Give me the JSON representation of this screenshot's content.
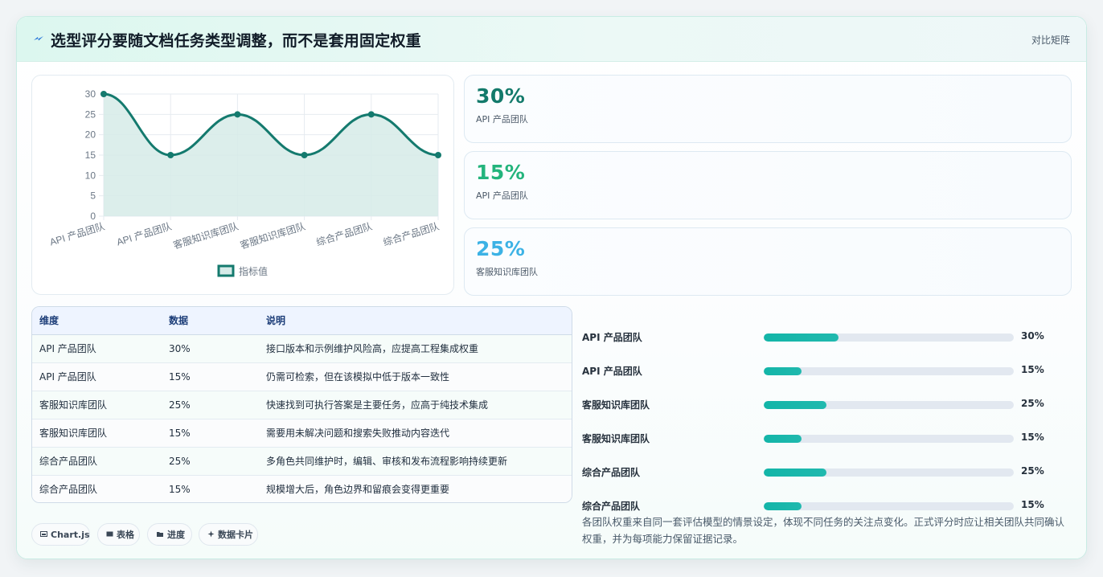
{
  "header": {
    "title": "选型评分要随文档任务类型调整，而不是套用固定权重",
    "link": "对比矩阵"
  },
  "chart_data": {
    "type": "line",
    "categories": [
      "API 产品团队",
      "API 产品团队",
      "客服知识库团队",
      "客服知识库团队",
      "综合产品团队",
      "综合产品团队"
    ],
    "series": [
      {
        "name": "指标值",
        "values": [
          30,
          15,
          25,
          15,
          25,
          15
        ]
      }
    ],
    "ylim": [
      0,
      30
    ],
    "yticks": [
      "0",
      "5",
      "10",
      "15",
      "20",
      "25",
      "30"
    ],
    "grid": true,
    "legend": "bottom",
    "fill": true,
    "color": "#147a6e",
    "fill_color": "#d6ebe8"
  },
  "stats": [
    {
      "value": "30%",
      "label": "API 产品团队",
      "color": "#137a6b"
    },
    {
      "value": "15%",
      "label": "API 产品团队",
      "color": "#23b47c"
    },
    {
      "value": "25%",
      "label": "客服知识库团队",
      "color": "#3cb2e5"
    }
  ],
  "table": {
    "headers": [
      "维度",
      "数据",
      "说明"
    ],
    "rows": [
      [
        "API 产品团队",
        "30%",
        "接口版本和示例维护风险高，应提高工程集成权重"
      ],
      [
        "API 产品团队",
        "15%",
        "仍需可检索，但在该模拟中低于版本一致性"
      ],
      [
        "客服知识库团队",
        "25%",
        "快速找到可执行答案是主要任务，应高于纯技术集成"
      ],
      [
        "客服知识库团队",
        "15%",
        "需要用未解决问题和搜索失败推动内容迭代"
      ],
      [
        "综合产品团队",
        "25%",
        "多角色共同维护时，编辑、审核和发布流程影响持续更新"
      ],
      [
        "综合产品团队",
        "15%",
        "规模增大后，角色边界和留痕会变得更重要"
      ]
    ]
  },
  "progress": [
    {
      "label": "API 产品团队",
      "value": "30%",
      "fraction": 0.3
    },
    {
      "label": "API 产品团队",
      "value": "15%",
      "fraction": 0.15
    },
    {
      "label": "客服知识库团队",
      "value": "25%",
      "fraction": 0.25
    },
    {
      "label": "客服知识库团队",
      "value": "15%",
      "fraction": 0.15
    },
    {
      "label": "综合产品团队",
      "value": "25%",
      "fraction": 0.25
    },
    {
      "label": "综合产品团队",
      "value": "15%",
      "fraction": 0.15
    }
  ],
  "note": "各团队权重来自同一套评估模型的情景设定，体现不同任务的关注点变化。正式评分时应让相关团队共同确认权重，并为每项能力保留证据记录。",
  "tags": [
    {
      "icon": "chart-icon",
      "label": "Chart.js"
    },
    {
      "icon": "table-icon",
      "label": "表格"
    },
    {
      "icon": "progress-icon",
      "label": "进度"
    },
    {
      "icon": "card-icon",
      "label": "数据卡片"
    }
  ]
}
